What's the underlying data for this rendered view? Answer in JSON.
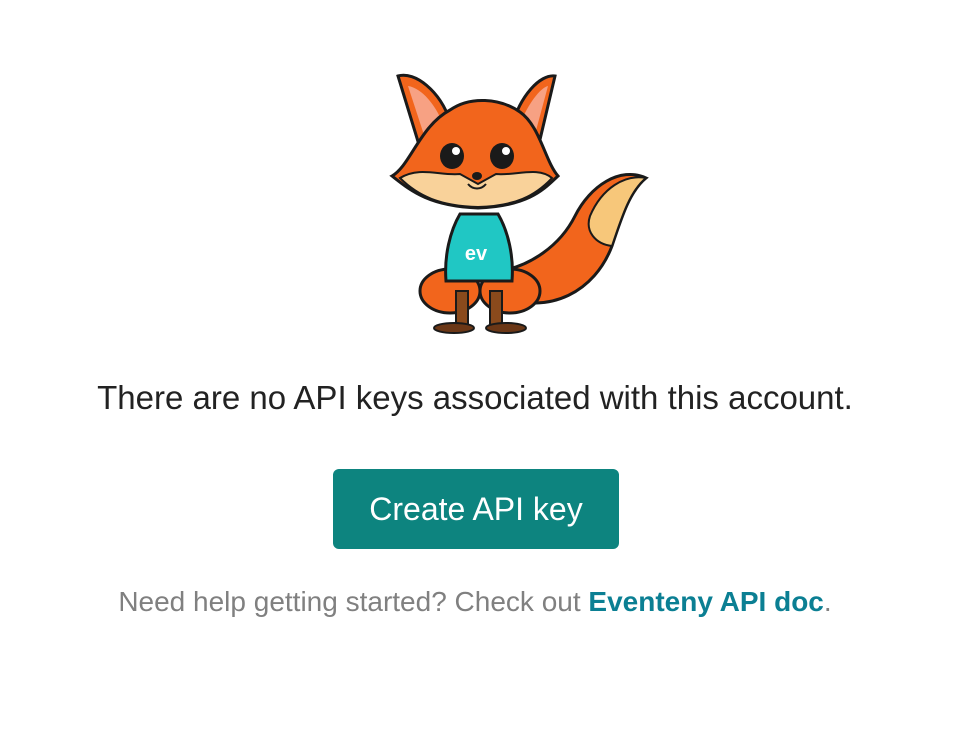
{
  "empty_state": {
    "mascot_shirt_text": "ev",
    "message": "There are no API keys associated with this account.",
    "create_button_label": "Create API key",
    "help_prefix": "Need help getting started? Check out ",
    "help_link_text": "Eventeny API doc",
    "help_suffix": "."
  },
  "colors": {
    "button_bg": "#0d847f",
    "link": "#0b7f93",
    "help_text": "#808080",
    "message_text": "#222222"
  }
}
